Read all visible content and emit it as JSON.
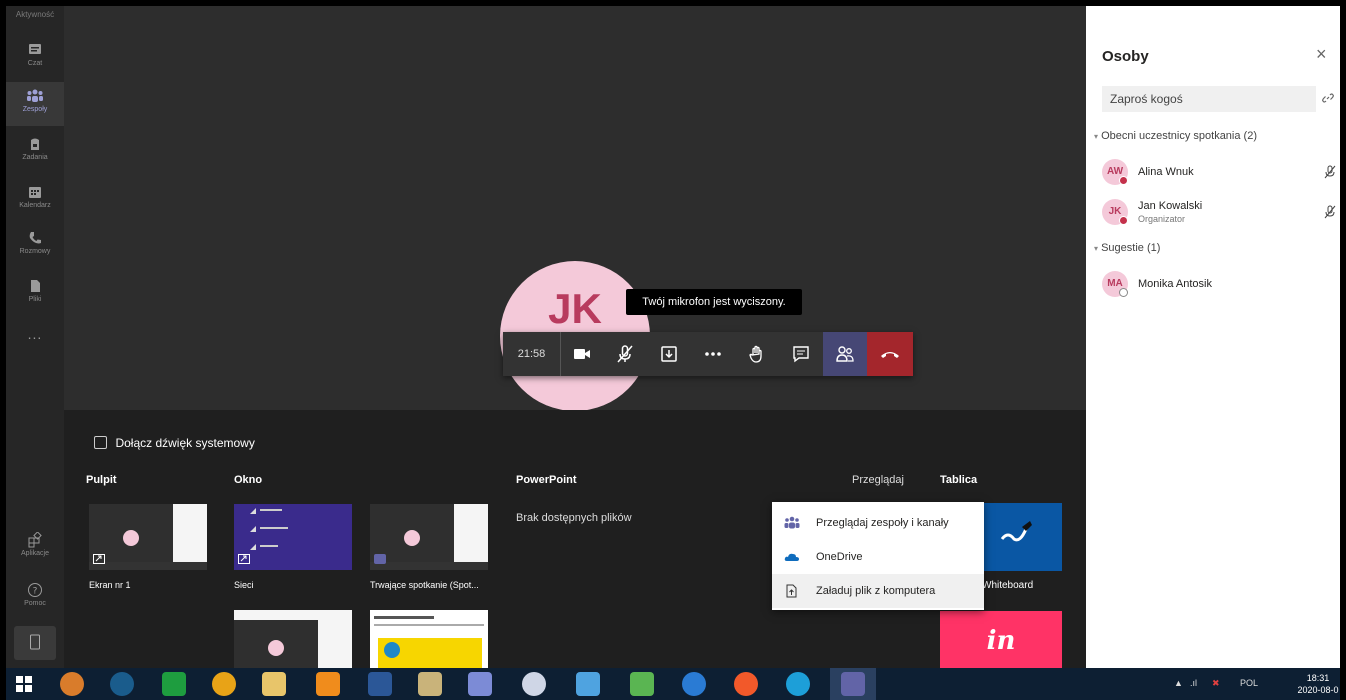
{
  "rail": {
    "top_label": "Aktywność",
    "items": [
      {
        "label": "Czat",
        "icon": "chat-icon"
      },
      {
        "label": "Zespoły",
        "icon": "teams-icon"
      },
      {
        "label": "Zadania",
        "icon": "assignments-icon"
      },
      {
        "label": "Kalendarz",
        "icon": "calendar-icon"
      },
      {
        "label": "Rozmowy",
        "icon": "phone-icon"
      },
      {
        "label": "Pliki",
        "icon": "files-icon"
      }
    ],
    "more": "...",
    "apps_label": "Aplikacje",
    "help_label": "Pomoc"
  },
  "stage": {
    "avatar_initials": "JK",
    "tooltip": "Twój mikrofon jest wyciszony."
  },
  "callbar": {
    "timer": "21:58",
    "buttons": [
      "camera-icon",
      "mic-off-icon",
      "share-icon",
      "more-icon",
      "raise-hand-icon",
      "chat-icon",
      "people-icon",
      "hang-up-icon"
    ]
  },
  "tray": {
    "system_audio_label": "Dołącz dźwięk systemowy",
    "sections": {
      "desktop": "Pulpit",
      "window": "Okno",
      "powerpoint": "PowerPoint",
      "whiteboard": "Tablica"
    },
    "browse": "Przeglądaj",
    "no_files": "Brak dostępnych plików",
    "desktop_thumbs": [
      {
        "title": "Ekran nr 1"
      }
    ],
    "window_thumbs": [
      {
        "title": "Sieci"
      },
      {
        "title": "Trwające spotkanie (Spot..."
      }
    ],
    "whiteboard_label": "Whiteboard",
    "invision_label": "in",
    "browse_menu": [
      {
        "label": "Przeglądaj zespoły i kanały",
        "icon": "teams-icon"
      },
      {
        "label": "OneDrive",
        "icon": "onedrive-icon"
      },
      {
        "label": "Załaduj plik z komputera",
        "icon": "upload-icon"
      }
    ]
  },
  "panel": {
    "title": "Osoby",
    "invite_placeholder": "Zaproś kogoś",
    "current_section": "Obecni uczestnicy spotkania (2)",
    "participants": [
      {
        "initials": "AW",
        "name": "Alina Wnuk",
        "role": ""
      },
      {
        "initials": "JK",
        "name": "Jan Kowalski",
        "role": "Organizator"
      }
    ],
    "suggestions_section": "Sugestie (1)",
    "suggestions": [
      {
        "initials": "MA",
        "name": "Monika Antosik"
      }
    ]
  },
  "taskbar": {
    "language": "POL",
    "time": "18:31",
    "date": "2020-08-0"
  },
  "colors": {
    "accent": "#6264a7",
    "hangup": "#a4262c",
    "avatar_bg": "#f4c9d9",
    "avatar_text": "#b83b5e"
  }
}
